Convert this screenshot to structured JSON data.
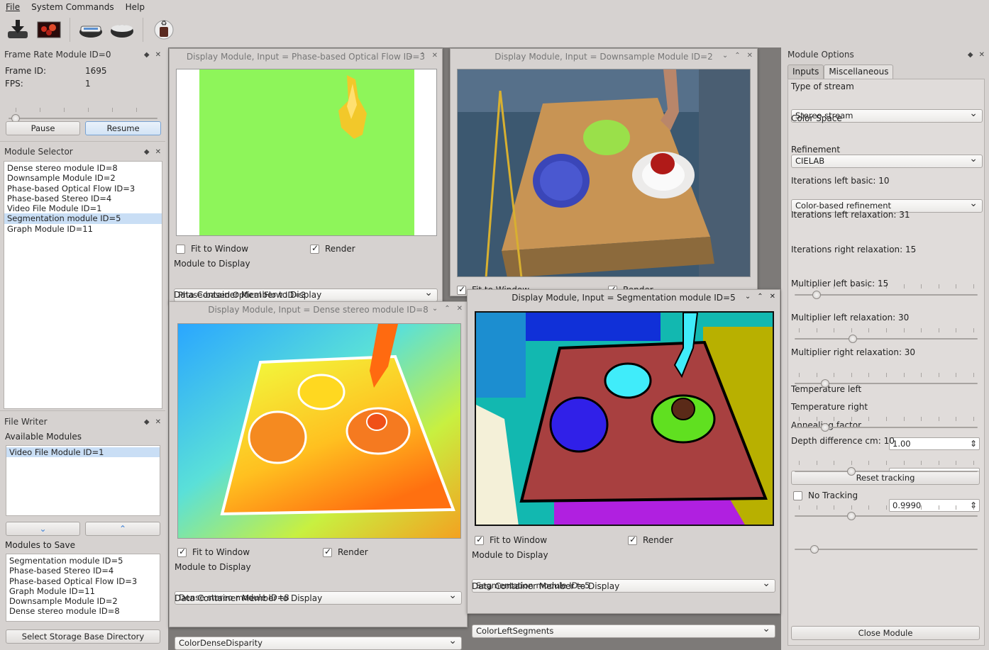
{
  "menu": {
    "file": "File",
    "system": "System Commands",
    "help": "Help"
  },
  "toolbar": {
    "icons": [
      "download-icon",
      "image-icon",
      "scanner-icon",
      "drive-icon",
      "recycle-icon"
    ]
  },
  "frame_rate": {
    "title": "Frame Rate Module ID=0",
    "frame_id_label": "Frame ID:",
    "frame_id": "1695",
    "fps_label": "FPS:",
    "fps": "1",
    "pause": "Pause",
    "resume": "Resume"
  },
  "module_selector": {
    "title": "Module Selector",
    "items": [
      "Dense stereo module ID=8",
      "Downsample Module ID=2",
      "Phase-based Optical Flow ID=3",
      "Phase-based Stereo ID=4",
      "Video File Module ID=1",
      "Segmentation module ID=5",
      "Graph Module ID=11"
    ]
  },
  "file_writer": {
    "title": "File Writer",
    "available_label": "Available Modules",
    "available": [
      "Video File Module ID=1"
    ],
    "save_label": "Modules to Save",
    "save": [
      "Segmentation module ID=5",
      "Phase-based Stereo ID=4",
      "Phase-based Optical Flow ID=3",
      "Graph Module ID=11",
      "Downsample Module ID=2",
      "Dense stereo module ID=8"
    ],
    "select_dir": "Select Storage Base Directory"
  },
  "win_flow": {
    "title": "Display Module, Input = Phase-based Optical Flow ID=3",
    "fit": "Fit to Window",
    "render": "Render",
    "module_label": "Module to Display",
    "module": "Phase-based Optical Flow ID=3",
    "member_label": "Data Container Member to Display"
  },
  "win_down": {
    "title": "Display Module, Input = Downsample Module ID=2",
    "fit": "Fit to Window",
    "render": "Render"
  },
  "win_dense": {
    "title": "Display Module, Input = Dense stereo module ID=8",
    "fit": "Fit to Window",
    "render": "Render",
    "module_label": "Module to Display",
    "module": "Dense stereo module ID=8",
    "member_label": "Data Container Member to Display",
    "member": "ColorDenseDisparity"
  },
  "win_seg": {
    "title": "Display Module, Input = Segmentation module ID=5",
    "fit": "Fit to Window",
    "render": "Render",
    "module_label": "Module to Display",
    "module": "Segmentation module ID=5",
    "member_label": "Data Container Member to Display",
    "member": "ColorLeftSegments"
  },
  "options": {
    "title": "Module Options",
    "tab_inputs": "Inputs",
    "tab_misc": "Miscellaneous",
    "stream_label": "Type of stream",
    "stream": "Stereo stream",
    "color_label": "Color Space",
    "color": "CIELAB",
    "refine_label": "Refinement",
    "refine": "Color-based refinement",
    "sliders": [
      {
        "label": "Iterations left basic: 10",
        "value": 10
      },
      {
        "label": "Iterations left relaxation: 31",
        "value": 31
      },
      {
        "label": "Iterations right relaxation: 15",
        "value": 15
      },
      {
        "label": "Multiplier left basic: 15",
        "value": 15
      },
      {
        "label": "Multiplier left relaxation: 30",
        "value": 30
      },
      {
        "label": "Multiplier right relaxation: 30",
        "value": 30
      }
    ],
    "temp_left_label": "Temperature left",
    "temp_left": "1.00",
    "temp_right_label": "Temperature right",
    "temp_right": "1.00",
    "anneal_label": "Annealing factor",
    "anneal": "0.9990",
    "depth_label": "Depth difference cm: 10",
    "reset": "Reset tracking",
    "no_tracking": "No Tracking",
    "close": "Close Module"
  },
  "colors": {
    "selection": "#c9def5",
    "background": "#d6d2d0",
    "mdi": "#7d7a78"
  }
}
